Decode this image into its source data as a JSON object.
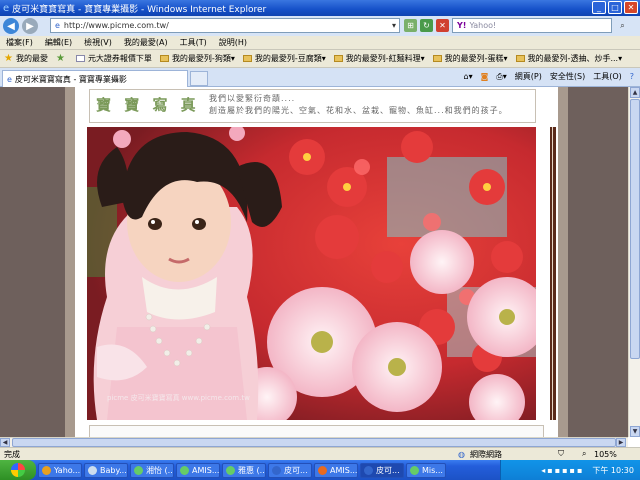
{
  "window": {
    "title": "皮可米寶寶寫真 - 寶寶專業攝影 - Windows Internet Explorer"
  },
  "address": {
    "url": "http://www.picme.com.tw/",
    "search_placeholder": "Yahoo!"
  },
  "menu": [
    "檔案(F)",
    "編輯(E)",
    "檢視(V)",
    "我的最愛(A)",
    "工具(T)",
    "說明(H)"
  ],
  "favorites": {
    "label": "我的最愛",
    "items": [
      "元大證券報價下單",
      "我的最愛列-狗類",
      "我的最愛列-豆腐類",
      "我的最愛列-紅麵料理",
      "我的最愛列-蛋糕",
      "我的最愛列-透抽、炒手..."
    ]
  },
  "tab": {
    "title": "皮可米寶寶寫真 - 寶寶專業攝影"
  },
  "commands": [
    "網頁(P)",
    "安全性(S)",
    "工具(O)"
  ],
  "page": {
    "logo": "寶 寶 寫 真",
    "slogan_line1": "我們以愛緊衍奇蹟....",
    "slogan_line2": "創造屬於我們的陽光、空氣、花和水、盆栽、寵物、魚缸...和我們的孩子。",
    "watermark": "picme 皮可米寶寶寫真 www.picme.com.tw"
  },
  "status": {
    "left": "完成",
    "zone": "網際網路",
    "zoom": "105%"
  },
  "taskbar": {
    "items": [
      "Yaho...",
      "Baby...",
      "湘怡 (...",
      "AMIS...",
      "雅惠 (...",
      "皮可...",
      "AMIS...",
      "皮可...",
      "Mis..."
    ],
    "clock": "下午 10:30"
  },
  "colors": {
    "logo": "#7b9a5a",
    "side_panel": "#6e605c",
    "titlebar": "#1550c8"
  }
}
